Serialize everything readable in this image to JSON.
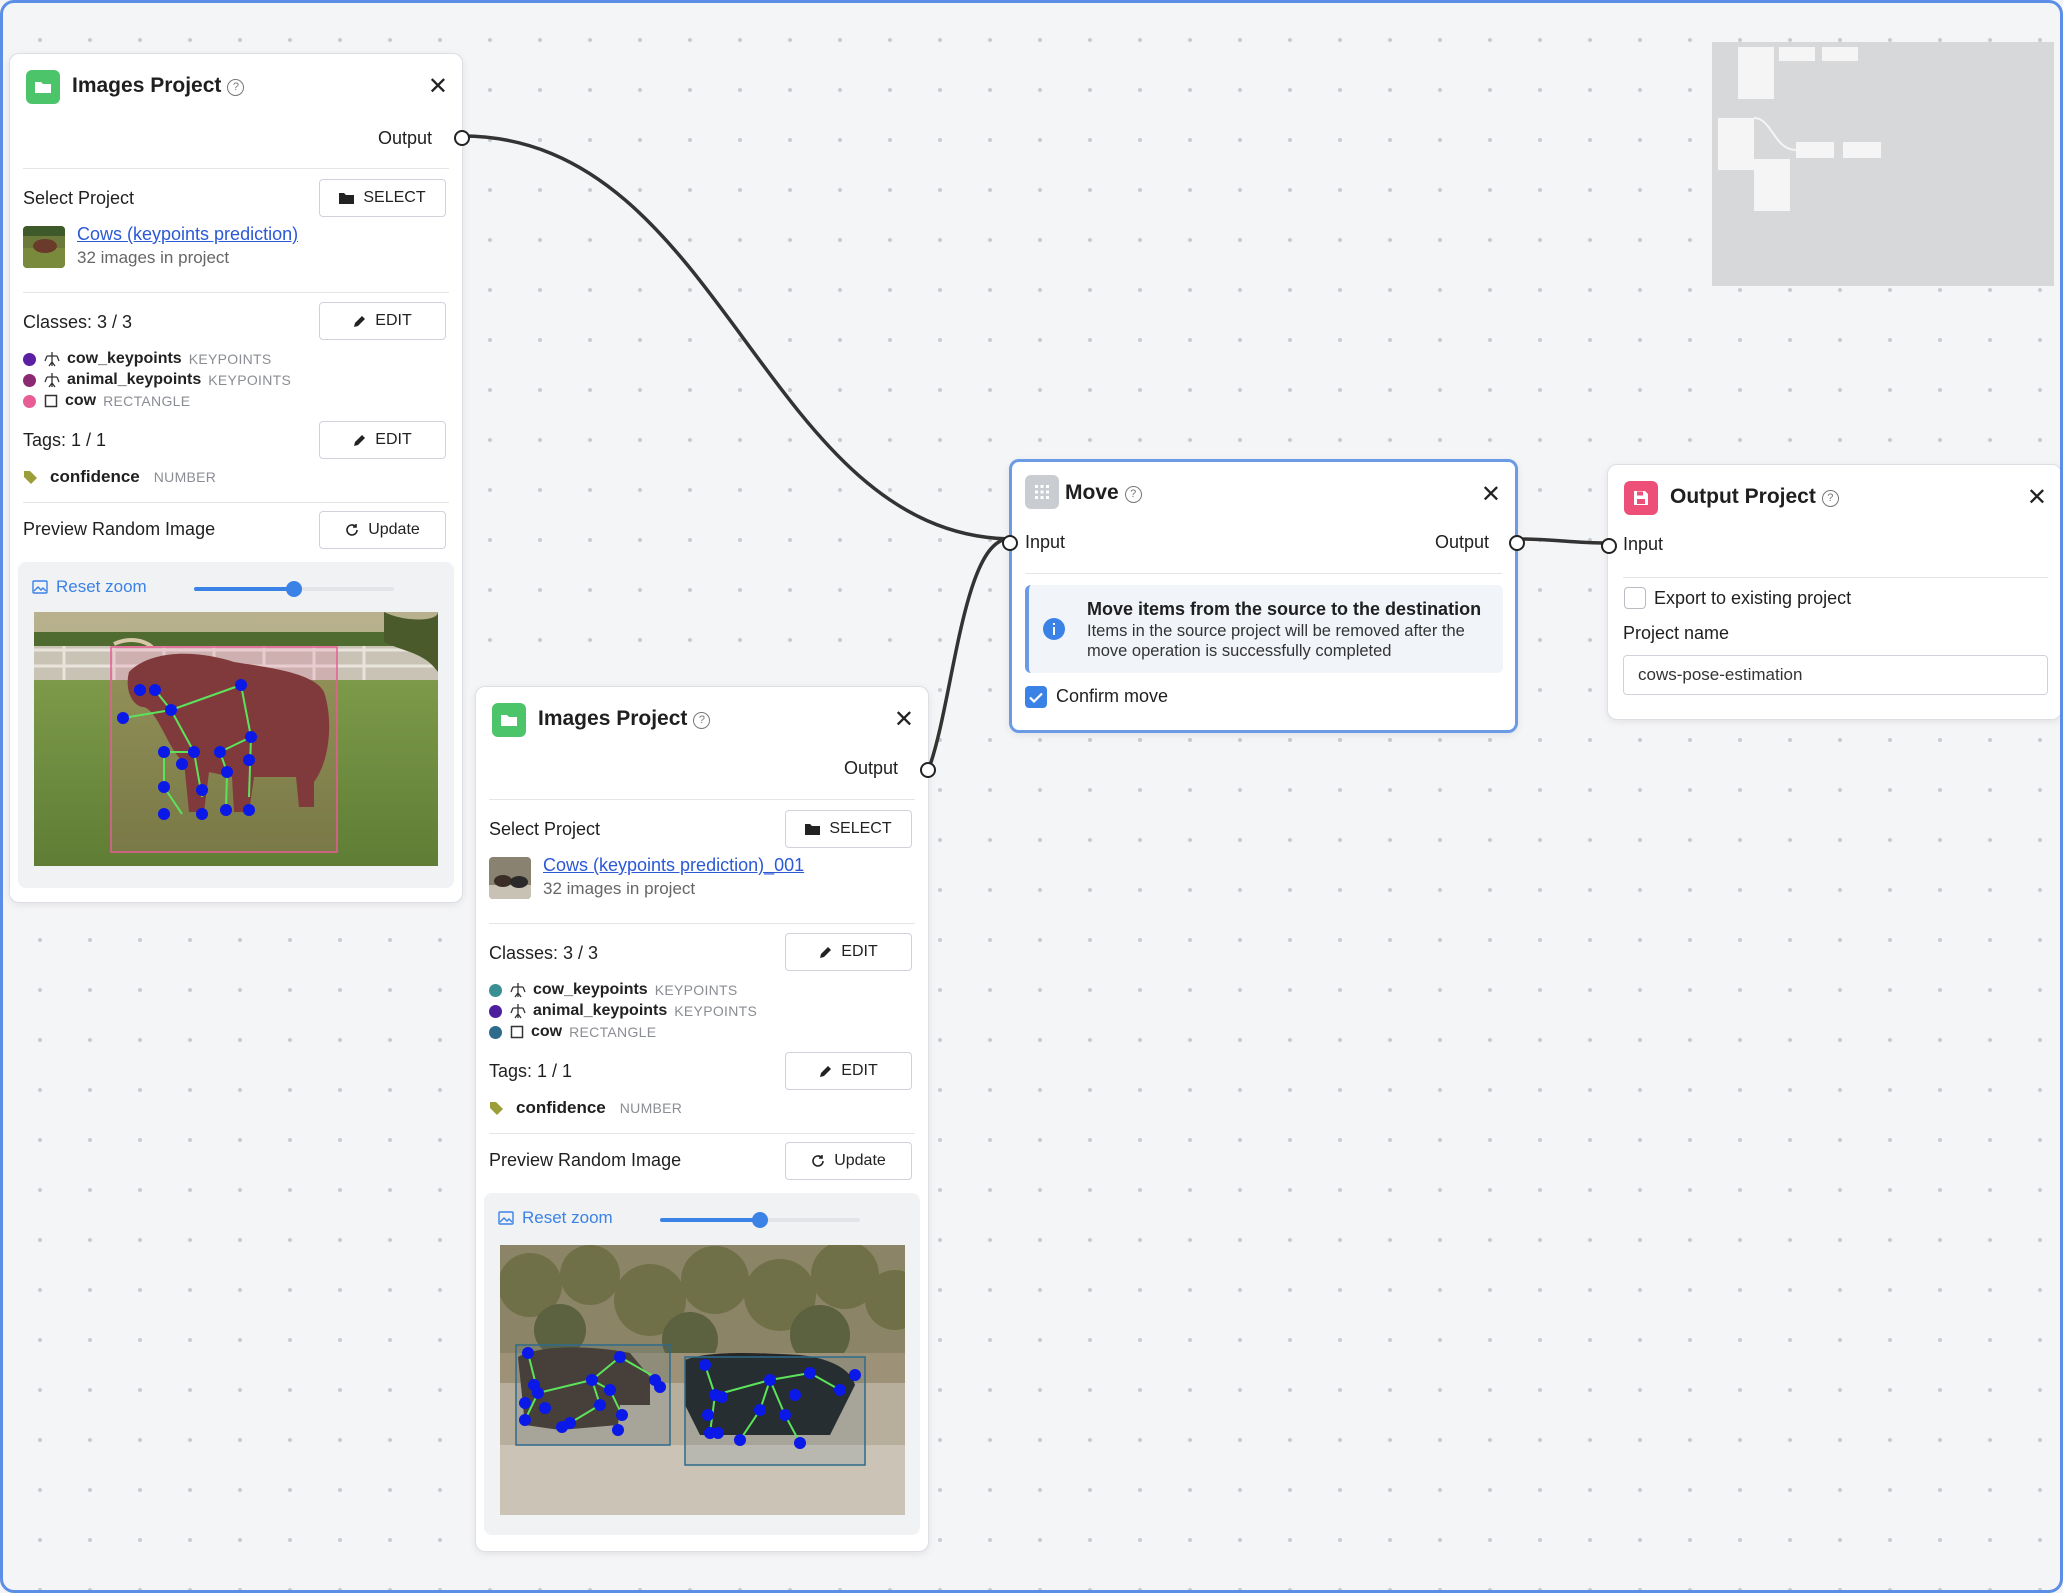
{
  "colors": {
    "accent": "#3b82e6",
    "images_node_icon": "#4cc46a",
    "move_node_icon": "#c9ccd1",
    "output_node_icon": "#ee4f79",
    "canvas_border": "#5b8ee6"
  },
  "node_images_1": {
    "title": "Images Project",
    "output_label": "Output",
    "select_project_label": "Select Project",
    "select_button": "SELECT",
    "project_name": "Cows (keypoints prediction)",
    "project_count": "32 images in project",
    "classes_label": "Classes: 3 / 3",
    "edit_button": "EDIT",
    "classes": [
      {
        "name": "cow_keypoints",
        "type": "KEYPOINTS",
        "color": "#5a1fa3",
        "shape_icon": "graph-icon"
      },
      {
        "name": "animal_keypoints",
        "type": "KEYPOINTS",
        "color": "#8b2a72",
        "shape_icon": "graph-icon"
      },
      {
        "name": "cow",
        "type": "RECTANGLE",
        "color": "#e85d95",
        "shape_icon": "rectangle-icon"
      }
    ],
    "tags_label": "Tags: 1 / 1",
    "tags_edit_button": "EDIT",
    "tag": {
      "name": "confidence",
      "type": "NUMBER",
      "color": "#9c9e3a"
    },
    "preview_label": "Preview Random Image",
    "update_button": "Update",
    "reset_zoom": "Reset zoom",
    "zoom_level": 0.5
  },
  "node_images_2": {
    "title": "Images Project",
    "output_label": "Output",
    "select_project_label": "Select Project",
    "select_button": "SELECT",
    "project_name": "Cows (keypoints prediction)_001",
    "project_count": "32 images in project",
    "classes_label": "Classes: 3 / 3",
    "edit_button": "EDIT",
    "classes": [
      {
        "name": "cow_keypoints",
        "type": "KEYPOINTS",
        "color": "#3a8f93",
        "shape_icon": "graph-icon"
      },
      {
        "name": "animal_keypoints",
        "type": "KEYPOINTS",
        "color": "#4b1f9e",
        "shape_icon": "graph-icon"
      },
      {
        "name": "cow",
        "type": "RECTANGLE",
        "color": "#2e6a8c",
        "shape_icon": "rectangle-icon"
      }
    ],
    "tags_label": "Tags: 1 / 1",
    "tags_edit_button": "EDIT",
    "tag": {
      "name": "confidence",
      "type": "NUMBER",
      "color": "#9c9e3a"
    },
    "preview_label": "Preview Random Image",
    "update_button": "Update",
    "reset_zoom": "Reset zoom",
    "zoom_level": 0.5
  },
  "node_move": {
    "title": "Move",
    "input_label": "Input",
    "output_label": "Output",
    "info_title": "Move items from the source to the destination",
    "info_text": "Items in the source project will be removed after the move operation is successfully completed",
    "confirm_label": "Confirm move",
    "confirm_checked": true
  },
  "node_output": {
    "title": "Output Project",
    "input_label": "Input",
    "export_label": "Export to existing project",
    "export_checked": false,
    "project_name_label": "Project name",
    "project_name_value": "cows-pose-estimation"
  }
}
